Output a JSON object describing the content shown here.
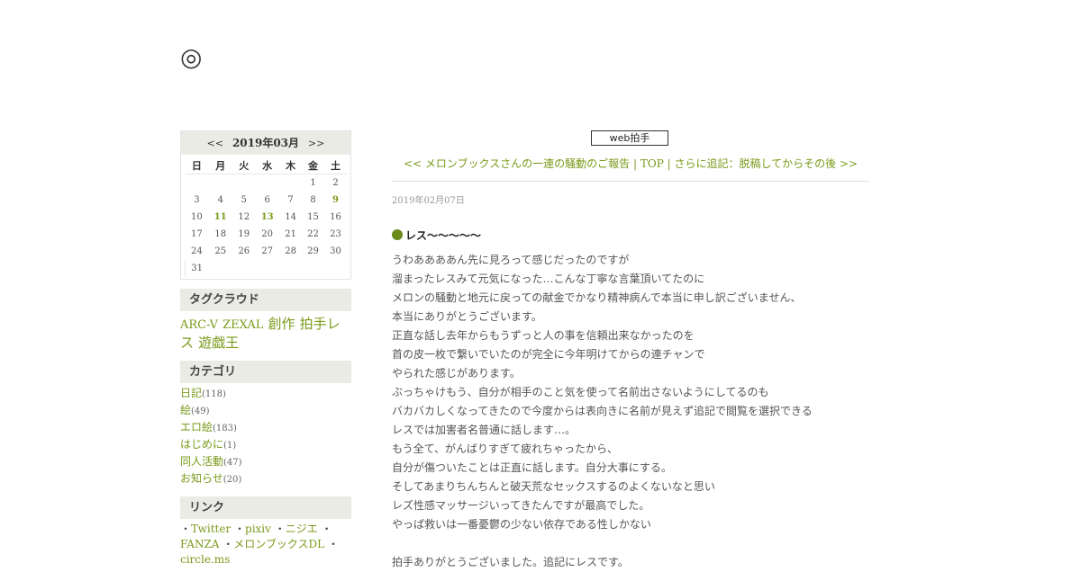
{
  "site": {
    "title": "◎"
  },
  "calendar": {
    "prev": "<<",
    "title": "2019年03月",
    "next": ">>",
    "weekdays": [
      "日",
      "月",
      "火",
      "水",
      "木",
      "金",
      "土"
    ],
    "weeks": [
      [
        "",
        "",
        "",
        "",
        "",
        "1",
        "2"
      ],
      [
        "3",
        "4",
        "5",
        "6",
        "7",
        "8",
        "9"
      ],
      [
        "10",
        "11",
        "12",
        "13",
        "14",
        "15",
        "16"
      ],
      [
        "17",
        "18",
        "19",
        "20",
        "21",
        "22",
        "23"
      ],
      [
        "24",
        "25",
        "26",
        "27",
        "28",
        "29",
        "30"
      ],
      [
        "31",
        "",
        "",
        "",
        "",
        "",
        ""
      ]
    ],
    "linked_days": [
      "9",
      "11",
      "13"
    ]
  },
  "tagcloud": {
    "heading": "タグクラウド",
    "tags": [
      {
        "label": "ARC-V",
        "size": "s"
      },
      {
        "label": "ZEXAL",
        "size": "s"
      },
      {
        "label": "創作",
        "size": "l"
      },
      {
        "label": "拍手レス",
        "size": "l"
      },
      {
        "label": "遊戯王",
        "size": "l"
      }
    ]
  },
  "categories": {
    "heading": "カテゴリ",
    "items": [
      {
        "label": "日記",
        "count": "(118)"
      },
      {
        "label": "絵",
        "count": "(49)"
      },
      {
        "label": "エロ絵",
        "count": "(183)"
      },
      {
        "label": "はじめに",
        "count": "(1)"
      },
      {
        "label": "同人活動",
        "count": "(47)"
      },
      {
        "label": "お知らせ",
        "count": "(20)"
      }
    ]
  },
  "links": {
    "heading": "リンク",
    "items": [
      "Twitter",
      "pixiv",
      "ニジエ",
      "FANZA",
      "メロンブックスDL",
      "circle.ms"
    ]
  },
  "main": {
    "clap_button": "web拍手",
    "prev_link": "<< メロンブックスさんの一連の騒動のご報告",
    "sep1": "|",
    "top_link": "TOP",
    "sep2": "|",
    "next_link": "さらに追記：脱稿してからその後 >>",
    "date": "2019年02月07日",
    "entry_title": "レス～～～～～",
    "lines": [
      "うわああああん先に見ろって感じだったのですが",
      "溜まったレスみて元気になった…こんな丁寧な言葉頂いてたのに",
      "メロンの騒動と地元に戻っての献金でかなり精神病んで本当に申し訳ございません、",
      "本当にありがとうございます。",
      "正直な話し去年からもうずっと人の事を信頼出来なかったのを",
      "首の皮一枚で繋いでいたのが完全に今年明けてからの連チャンで",
      "やられた感じがあります。",
      "ぶっちゃけもう、自分が相手のこと気を使って名前出さないようにしてるのも",
      "バカバカしくなってきたので今度からは表向きに名前が見えず追記で閲覧を選択できる",
      "レスでは加害者名普通に話します…。",
      "もう全て、がんばりすぎて疲れちゃったから、",
      "自分が傷ついたことは正直に話します。自分大事にする。",
      "そしてあまりちんちんと破天荒なセックスするのよくないなと思い",
      "レズ性感マッサージいってきたんですが最高でした。",
      "やっぱ救いは一番憂鬱の少ない依存である性しかない",
      "",
      "拍手ありがとうございました。追記にレスです。"
    ]
  }
}
